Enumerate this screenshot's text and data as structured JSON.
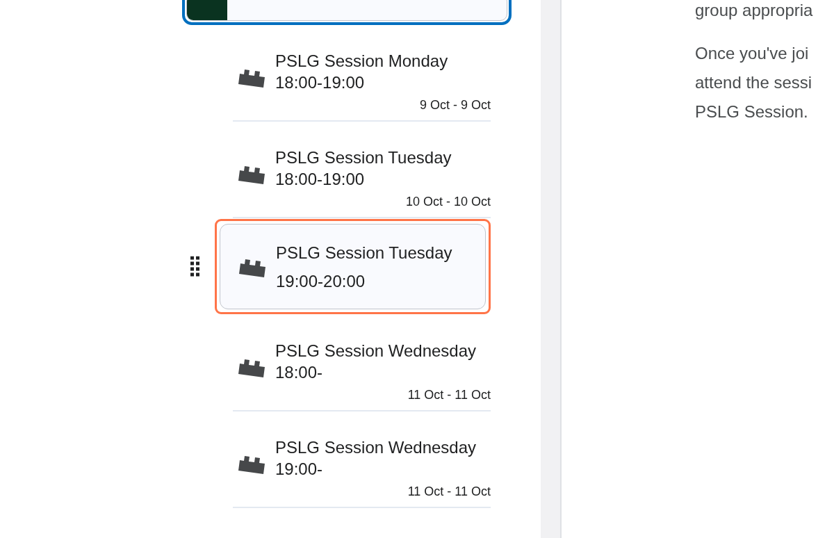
{
  "top_item": {
    "focused": true
  },
  "sessions": [
    {
      "title": "PSLG Session Monday 18:00-19:00",
      "dates": "9 Oct - 9 Oct",
      "selected": false
    },
    {
      "title": "PSLG Session Tuesday 18:00-19:00",
      "dates": "10 Oct - 10 Oct",
      "selected": false
    },
    {
      "title": "PSLG Session Tuesday 19:00-20:00",
      "selected": true
    },
    {
      "title": "PSLG Session Wednesday 18:00-",
      "dates": "11 Oct - 11 Oct",
      "selected": false
    },
    {
      "title": "PSLG Session Wednesday 19:00-",
      "dates": "11 Oct - 11 Oct",
      "selected": false
    }
  ],
  "description": {
    "paragraphs": [
      [
        "group appropria"
      ],
      [
        "Once you've joi",
        "attend the sessi",
        "PSLG Session."
      ]
    ]
  }
}
